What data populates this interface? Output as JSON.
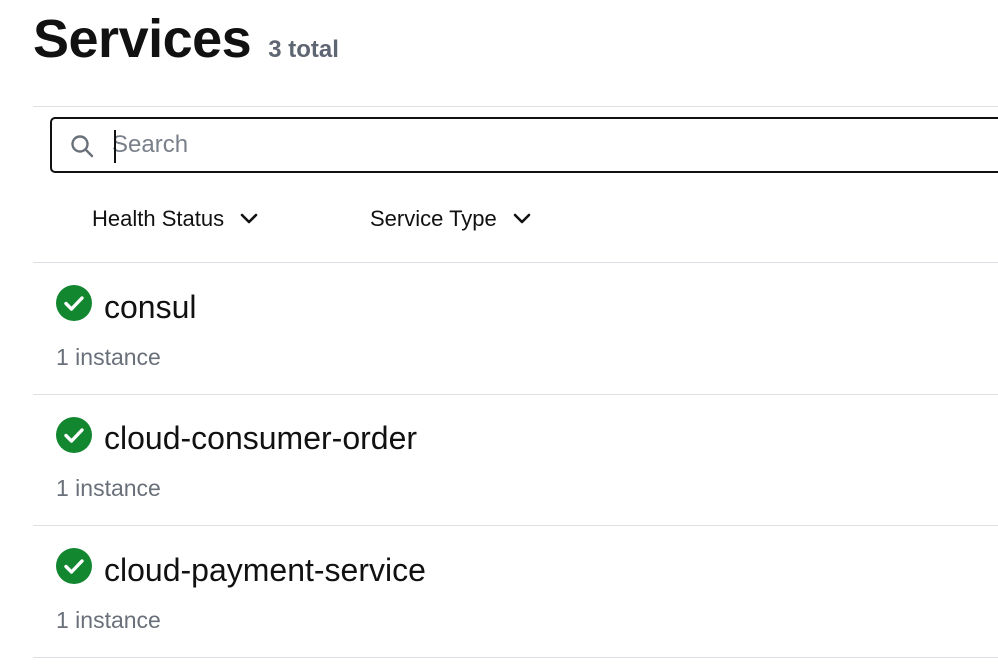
{
  "header": {
    "title": "Services",
    "total": "3 total"
  },
  "search": {
    "placeholder": "Search",
    "value": ""
  },
  "filters": [
    {
      "label": "Health Status",
      "icon": "chevron-down-icon"
    },
    {
      "label": "Service Type",
      "icon": "chevron-down-icon"
    }
  ],
  "services": [
    {
      "name": "consul",
      "instances": "1 instance",
      "status": "passing",
      "status_icon": "check-circle-icon"
    },
    {
      "name": "cloud-consumer-order",
      "instances": "1 instance",
      "status": "passing",
      "status_icon": "check-circle-icon"
    },
    {
      "name": "cloud-payment-service",
      "instances": "1 instance",
      "status": "passing",
      "status_icon": "check-circle-icon"
    }
  ],
  "colors": {
    "passing": "#12872f",
    "muted_text": "#6a707a",
    "divider": "#dcdfe3"
  }
}
